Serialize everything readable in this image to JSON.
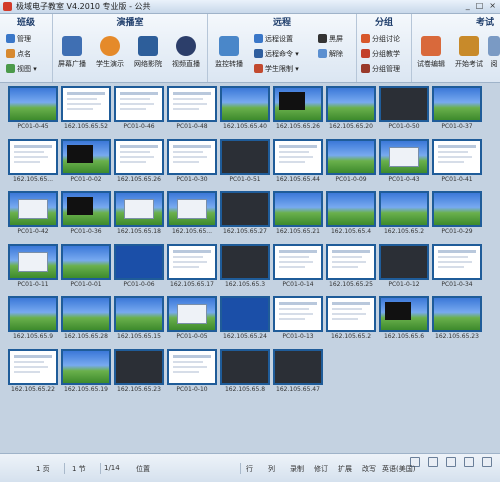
{
  "window": {
    "title": "极域电子教室 V4.2010 专业版 - 公共",
    "controls": [
      "_",
      "□",
      "×"
    ]
  },
  "ribbon": {
    "groups": [
      {
        "id": "class",
        "label": "班级"
      },
      {
        "id": "demo",
        "label": "演播室"
      },
      {
        "id": "remote",
        "label": "远程"
      },
      {
        "id": "group",
        "label": "分组"
      },
      {
        "id": "exam",
        "label": "考试"
      }
    ],
    "class_items": [
      "管理",
      "点名",
      "视图 ▾"
    ],
    "demo_items": [
      "屏幕广播",
      "学生演示",
      "网络影院",
      "视频直播"
    ],
    "remote_big": "监控转播",
    "remote_items": [
      "远程设置",
      "远程命令 ▾",
      "学生限制 ▾"
    ],
    "remote_items2": [
      "黑屏",
      "解除"
    ],
    "group_items": [
      "分组讨论",
      "分组教学",
      "分组管理"
    ],
    "exam_items": [
      "试卷编辑",
      "开始考试",
      "阅"
    ]
  },
  "tiles": [
    {
      "label": "PC01-0-45",
      "kind": "xp"
    },
    {
      "label": "162.105.65.52",
      "kind": "doc"
    },
    {
      "label": "PC01-0-46",
      "kind": "doc"
    },
    {
      "label": "PC01-0-48",
      "kind": "doc"
    },
    {
      "label": "162.105.65.40",
      "kind": "xp"
    },
    {
      "label": "162.105.65.26",
      "kind": "blackwin"
    },
    {
      "label": "162.105.65.20",
      "kind": "xp"
    },
    {
      "label": "PC01-0-50",
      "kind": "dark"
    },
    {
      "label": "PC01-0-37",
      "kind": "xp"
    },
    {
      "label": "162.105.65...",
      "kind": "doc"
    },
    {
      "label": "PC01-0-02",
      "kind": "blackwin"
    },
    {
      "label": "162.105.65.26",
      "kind": "doc"
    },
    {
      "label": "PC01-0-30",
      "kind": "doc"
    },
    {
      "label": "PC01-0-51",
      "kind": "dark"
    },
    {
      "label": "162.105.65.44",
      "kind": "doc"
    },
    {
      "label": "PC01-0-09",
      "kind": "xp"
    },
    {
      "label": "PC01-0-43",
      "kind": "dlgxp"
    },
    {
      "label": "PC01-0-41",
      "kind": "doc"
    },
    {
      "label": "PC01-0-42",
      "kind": "dlgxp"
    },
    {
      "label": "PC01-0-36",
      "kind": "blackwin"
    },
    {
      "label": "162.105.65.18",
      "kind": "dlgxp"
    },
    {
      "label": "162.105.65...",
      "kind": "dlgxp"
    },
    {
      "label": "162.105.65.27",
      "kind": "dark"
    },
    {
      "label": "162.105.65.21",
      "kind": "xp"
    },
    {
      "label": "162.105.65.4",
      "kind": "xp"
    },
    {
      "label": "162.105.65.2",
      "kind": "xp"
    },
    {
      "label": "PC01-0-29",
      "kind": "xp"
    },
    {
      "label": "PC01-0-11",
      "kind": "dlgxp"
    },
    {
      "label": "PC01-0-01",
      "kind": "xp"
    },
    {
      "label": "PC01-0-06",
      "kind": "blue"
    },
    {
      "label": "162.105.65.17",
      "kind": "doc"
    },
    {
      "label": "162.105.65.3",
      "kind": "dark"
    },
    {
      "label": "PC01-0-14",
      "kind": "doc"
    },
    {
      "label": "162.105.65.25",
      "kind": "doc"
    },
    {
      "label": "PC01-0-12",
      "kind": "dark"
    },
    {
      "label": "PC01-0-34",
      "kind": "doc"
    },
    {
      "label": "162.105.65.9",
      "kind": "xp"
    },
    {
      "label": "162.105.65.28",
      "kind": "xp"
    },
    {
      "label": "162.105.65.15",
      "kind": "xp"
    },
    {
      "label": "PC01-0-05",
      "kind": "dlgxp"
    },
    {
      "label": "162.105.65.24",
      "kind": "blue"
    },
    {
      "label": "PC01-0-13",
      "kind": "doc"
    },
    {
      "label": "162.105.65.2",
      "kind": "doc"
    },
    {
      "label": "162.105.65.6",
      "kind": "blackwin"
    },
    {
      "label": "162.105.65.23",
      "kind": "xp"
    },
    {
      "label": "162.105.65.22",
      "kind": "doc"
    },
    {
      "label": "162.105.65.19",
      "kind": "xp"
    },
    {
      "label": "162.105.65.23",
      "kind": "dark"
    },
    {
      "label": "PC01-0-10",
      "kind": "doc"
    },
    {
      "label": "162.105.65.8",
      "kind": "dark"
    },
    {
      "label": "162.105.65.47",
      "kind": "dark"
    }
  ],
  "statusbar": {
    "page": "1 页",
    "section": "1 节",
    "pos": "1/14",
    "location": "位置",
    "items": [
      "行",
      "列",
      "录制",
      "修订",
      "扩展",
      "改写"
    ],
    "lang": "英语(美国)"
  }
}
